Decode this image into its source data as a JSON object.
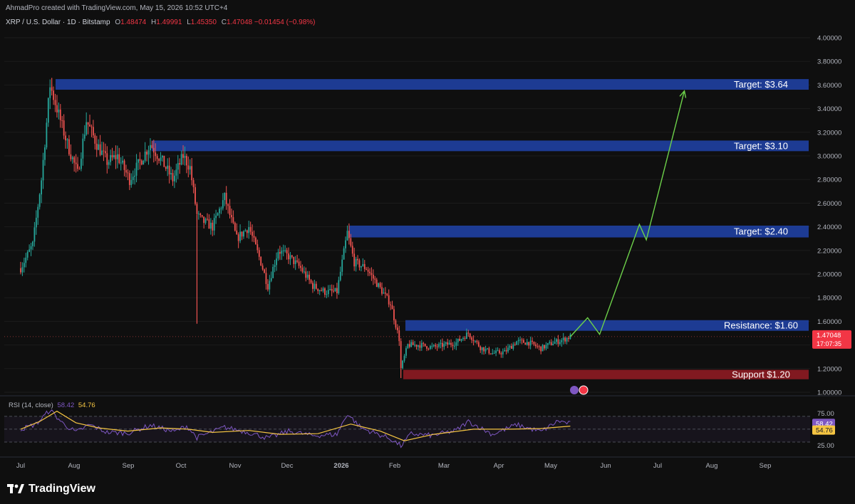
{
  "header": {
    "created_by": "AhmadPro created with TradingView.com, May 15, 2026 10:52 UTC+4"
  },
  "legend": {
    "symbol": "XRP / U.S. Dollar · 1D · Bitstamp",
    "o_label": "O",
    "o_value": "1.48474",
    "h_label": "H",
    "h_value": "1.49991",
    "l_label": "L",
    "l_value": "1.45350",
    "c_label": "C",
    "c_value": "1.47048",
    "change": "−0.01454 (−0.98%)"
  },
  "colors": {
    "background": "#0f0f0f",
    "up": "#26a69a",
    "down": "#ef5350",
    "zone_blue": "#1e3f9e",
    "zone_red": "#8b1a22",
    "projection": "#6dd14a",
    "rsi_line": "#7e57c2",
    "rsi_ma": "#f5c542"
  },
  "chart_data": {
    "type": "candlestick",
    "title": "XRP / U.S. Dollar · 1D · Bitstamp",
    "price_axis": {
      "ticks": [
        "4.00000",
        "3.80000",
        "3.60000",
        "3.40000",
        "3.20000",
        "3.00000",
        "2.80000",
        "2.60000",
        "2.40000",
        "2.20000",
        "2.00000",
        "1.80000",
        "1.60000",
        "1.40000",
        "1.20000",
        "1.00000"
      ],
      "ylim": [
        1.0,
        4.0
      ]
    },
    "time_axis": {
      "labels": [
        "Jul",
        "Aug",
        "Sep",
        "Oct",
        "Nov",
        "Dec",
        "2026",
        "Feb",
        "Mar",
        "Apr",
        "May",
        "Jun",
        "Jul",
        "Aug",
        "Sep"
      ]
    },
    "price_path": [
      {
        "x": "2025-07-01",
        "y": 2.05
      },
      {
        "x": "2025-07-08",
        "y": 2.25
      },
      {
        "x": "2025-07-13",
        "y": 2.8
      },
      {
        "x": "2025-07-18",
        "y": 3.6
      },
      {
        "x": "2025-07-22",
        "y": 3.4
      },
      {
        "x": "2025-07-28",
        "y": 3.1
      },
      {
        "x": "2025-08-03",
        "y": 2.85
      },
      {
        "x": "2025-08-08",
        "y": 3.3
      },
      {
        "x": "2025-08-14",
        "y": 3.1
      },
      {
        "x": "2025-08-20",
        "y": 2.95
      },
      {
        "x": "2025-08-26",
        "y": 3.0
      },
      {
        "x": "2025-09-02",
        "y": 2.8
      },
      {
        "x": "2025-09-08",
        "y": 2.95
      },
      {
        "x": "2025-09-14",
        "y": 3.1
      },
      {
        "x": "2025-09-21",
        "y": 2.95
      },
      {
        "x": "2025-09-27",
        "y": 2.8
      },
      {
        "x": "2025-10-03",
        "y": 3.0
      },
      {
        "x": "2025-10-07",
        "y": 2.9
      },
      {
        "x": "2025-10-11",
        "y": 2.5
      },
      {
        "x": "2025-10-14",
        "y": 2.45
      },
      {
        "x": "2025-10-20",
        "y": 2.4
      },
      {
        "x": "2025-10-27",
        "y": 2.65
      },
      {
        "x": "2025-11-03",
        "y": 2.3
      },
      {
        "x": "2025-11-10",
        "y": 2.4
      },
      {
        "x": "2025-11-17",
        "y": 2.1
      },
      {
        "x": "2025-11-21",
        "y": 1.9
      },
      {
        "x": "2025-11-27",
        "y": 2.2
      },
      {
        "x": "2025-12-03",
        "y": 2.15
      },
      {
        "x": "2025-12-10",
        "y": 2.05
      },
      {
        "x": "2025-12-17",
        "y": 1.9
      },
      {
        "x": "2025-12-24",
        "y": 1.85
      },
      {
        "x": "2025-12-31",
        "y": 1.85
      },
      {
        "x": "2026-01-06",
        "y": 2.35
      },
      {
        "x": "2026-01-10",
        "y": 2.1
      },
      {
        "x": "2026-01-17",
        "y": 2.05
      },
      {
        "x": "2026-01-24",
        "y": 1.9
      },
      {
        "x": "2026-01-31",
        "y": 1.75
      },
      {
        "x": "2026-02-05",
        "y": 1.45
      },
      {
        "x": "2026-02-06",
        "y": 1.2
      },
      {
        "x": "2026-02-10",
        "y": 1.4
      },
      {
        "x": "2026-02-17",
        "y": 1.4
      },
      {
        "x": "2026-02-24",
        "y": 1.38
      },
      {
        "x": "2026-03-03",
        "y": 1.4
      },
      {
        "x": "2026-03-10",
        "y": 1.42
      },
      {
        "x": "2026-03-17",
        "y": 1.5
      },
      {
        "x": "2026-03-24",
        "y": 1.38
      },
      {
        "x": "2026-03-31",
        "y": 1.33
      },
      {
        "x": "2026-04-07",
        "y": 1.34
      },
      {
        "x": "2026-04-14",
        "y": 1.43
      },
      {
        "x": "2026-04-21",
        "y": 1.42
      },
      {
        "x": "2026-04-28",
        "y": 1.37
      },
      {
        "x": "2026-05-05",
        "y": 1.42
      },
      {
        "x": "2026-05-10",
        "y": 1.44
      },
      {
        "x": "2026-05-15",
        "y": 1.47
      }
    ],
    "wick_spikes": [
      {
        "x": "2025-10-11",
        "y": 1.58
      },
      {
        "x": "2025-07-19",
        "y": 3.66
      },
      {
        "x": "2026-02-06",
        "y": 1.12
      }
    ],
    "current_price": {
      "value": "1.47048",
      "countdown": "17:07:35"
    },
    "zones": [
      {
        "label": "Target: $3.64",
        "low": 3.56,
        "high": 3.65,
        "color": "blue"
      },
      {
        "label": "Target: $3.10",
        "low": 3.04,
        "high": 3.13,
        "color": "blue"
      },
      {
        "label": "Target: $2.40",
        "low": 2.31,
        "high": 2.41,
        "color": "blue"
      },
      {
        "label": "Resistance: $1.60",
        "low": 1.52,
        "high": 1.61,
        "color": "blue"
      },
      {
        "label": "Support $1.20",
        "low": 1.11,
        "high": 1.19,
        "color": "red"
      }
    ],
    "projection": [
      {
        "x": "2026-05-15",
        "y": 1.47
      },
      {
        "x": "2026-05-25",
        "y": 1.63
      },
      {
        "x": "2026-06-01",
        "y": 1.49
      },
      {
        "x": "2026-06-24",
        "y": 2.42
      },
      {
        "x": "2026-06-28",
        "y": 2.29
      },
      {
        "x": "2026-07-20",
        "y": 3.55
      }
    ],
    "rsi": {
      "label": "RSI (14, close)",
      "value": "58.42",
      "ma_value": "54.76",
      "ticks": [
        "75.00",
        "25.00"
      ],
      "ylim": [
        20,
        82
      ],
      "path": [
        {
          "x": "2025-07-01",
          "y": 50
        },
        {
          "x": "2025-07-10",
          "y": 58
        },
        {
          "x": "2025-07-18",
          "y": 80
        },
        {
          "x": "2025-07-25",
          "y": 60
        },
        {
          "x": "2025-08-02",
          "y": 45
        },
        {
          "x": "2025-08-10",
          "y": 57
        },
        {
          "x": "2025-08-20",
          "y": 45
        },
        {
          "x": "2025-09-01",
          "y": 44
        },
        {
          "x": "2025-09-14",
          "y": 56
        },
        {
          "x": "2025-09-28",
          "y": 46
        },
        {
          "x": "2025-10-05",
          "y": 55
        },
        {
          "x": "2025-10-11",
          "y": 37
        },
        {
          "x": "2025-10-27",
          "y": 53
        },
        {
          "x": "2025-11-10",
          "y": 45
        },
        {
          "x": "2025-11-21",
          "y": 36
        },
        {
          "x": "2025-12-03",
          "y": 47
        },
        {
          "x": "2025-12-17",
          "y": 40
        },
        {
          "x": "2025-12-31",
          "y": 42
        },
        {
          "x": "2026-01-06",
          "y": 74
        },
        {
          "x": "2026-01-14",
          "y": 52
        },
        {
          "x": "2026-01-31",
          "y": 35
        },
        {
          "x": "2026-02-06",
          "y": 24
        },
        {
          "x": "2026-02-12",
          "y": 43
        },
        {
          "x": "2026-02-24",
          "y": 40
        },
        {
          "x": "2026-03-10",
          "y": 48
        },
        {
          "x": "2026-03-17",
          "y": 62
        },
        {
          "x": "2026-03-31",
          "y": 42
        },
        {
          "x": "2026-04-14",
          "y": 57
        },
        {
          "x": "2026-04-28",
          "y": 46
        },
        {
          "x": "2026-05-08",
          "y": 63
        },
        {
          "x": "2026-05-15",
          "y": 58.42
        }
      ],
      "ma_path": [
        {
          "x": "2025-07-01",
          "y": 50
        },
        {
          "x": "2025-07-12",
          "y": 62
        },
        {
          "x": "2025-07-22",
          "y": 78
        },
        {
          "x": "2025-08-02",
          "y": 60
        },
        {
          "x": "2025-08-15",
          "y": 52
        },
        {
          "x": "2025-09-01",
          "y": 47
        },
        {
          "x": "2025-09-20",
          "y": 52
        },
        {
          "x": "2025-10-06",
          "y": 50
        },
        {
          "x": "2025-10-20",
          "y": 45
        },
        {
          "x": "2025-11-10",
          "y": 48
        },
        {
          "x": "2025-11-28",
          "y": 42
        },
        {
          "x": "2025-12-20",
          "y": 43
        },
        {
          "x": "2026-01-08",
          "y": 58
        },
        {
          "x": "2026-01-25",
          "y": 47
        },
        {
          "x": "2026-02-08",
          "y": 32
        },
        {
          "x": "2026-02-25",
          "y": 42
        },
        {
          "x": "2026-03-20",
          "y": 50
        },
        {
          "x": "2026-04-10",
          "y": 50
        },
        {
          "x": "2026-04-28",
          "y": 51
        },
        {
          "x": "2026-05-15",
          "y": 54.76
        }
      ]
    }
  },
  "footer": {
    "brand": "TradingView"
  }
}
